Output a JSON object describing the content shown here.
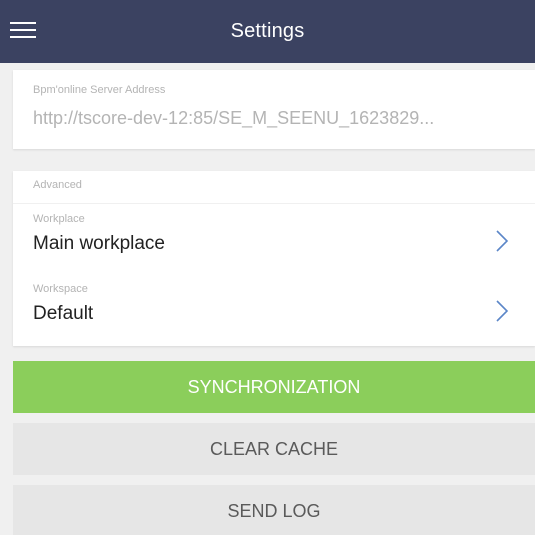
{
  "header": {
    "title": "Settings",
    "menu_icon": "hamburger-menu-icon"
  },
  "server": {
    "label": "Bpm'online Server Address",
    "value": "http://tscore-dev-12:85/SE_M_SEENU_1623829..."
  },
  "advanced": {
    "label": "Advanced",
    "workplace": {
      "label": "Workplace",
      "value": "Main workplace",
      "icon": "chevron-right-icon"
    },
    "workspace": {
      "label": "Workspace",
      "value": "Default",
      "icon": "chevron-right-icon"
    }
  },
  "actions": {
    "sync_label": "SYNCHRONIZATION",
    "clear_cache_label": "CLEAR CACHE",
    "send_log_label": "SEND LOG"
  },
  "colors": {
    "header_bg": "#3b4261",
    "sync_bg": "#8bce5b",
    "chevron": "#5b86c8"
  }
}
